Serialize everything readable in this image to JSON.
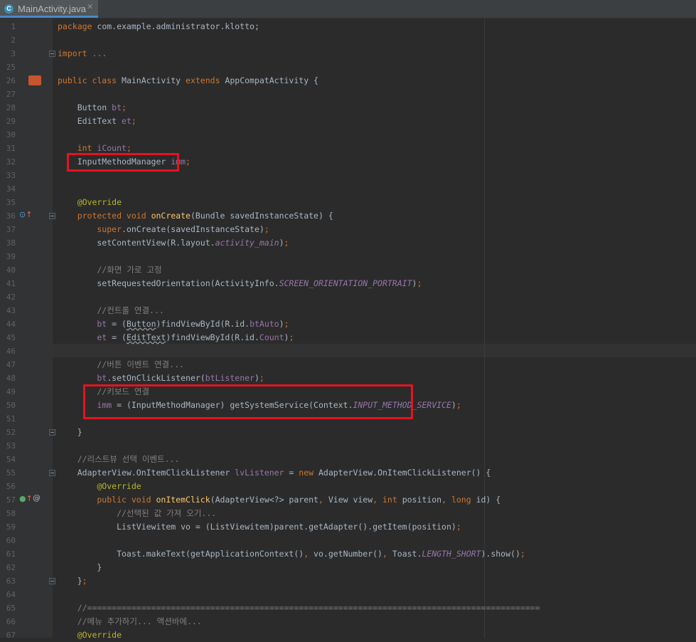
{
  "tab": {
    "filename": "MainActivity.java",
    "icon": "C",
    "close": "✕"
  },
  "colors": {
    "background": "#2b2b2b",
    "keyword": "#cc7832",
    "comment": "#808080",
    "annotation": "#bbb529",
    "method": "#ffc66d",
    "field": "#9876aa",
    "text": "#a9b7c6",
    "highlight_box": "#e4141f"
  },
  "lines": [
    {
      "n": "1",
      "t": [
        [
          "kw",
          "package "
        ],
        [
          "",
          "com.example.administrator.klotto;"
        ]
      ]
    },
    {
      "n": "2",
      "t": []
    },
    {
      "n": "3",
      "t": [
        [
          "kw",
          "import "
        ],
        [
          "cm",
          "..."
        ]
      ]
    },
    {
      "n": "25",
      "t": []
    },
    {
      "n": "26",
      "t": [
        [
          "kw",
          "public class "
        ],
        [
          "",
          "MainActivity "
        ],
        [
          "kw",
          "extends "
        ],
        [
          "",
          "AppCompatActivity {"
        ]
      ]
    },
    {
      "n": "27",
      "t": []
    },
    {
      "n": "28",
      "t": [
        [
          "",
          "    Button "
        ],
        [
          "fd",
          "bt"
        ],
        [
          "kw",
          ";"
        ]
      ]
    },
    {
      "n": "29",
      "t": [
        [
          "",
          "    EditText "
        ],
        [
          "fd",
          "et"
        ],
        [
          "kw",
          ";"
        ]
      ]
    },
    {
      "n": "30",
      "t": []
    },
    {
      "n": "31",
      "t": [
        [
          "kw",
          "    int "
        ],
        [
          "fd",
          "iCount"
        ],
        [
          "kw",
          ";"
        ]
      ]
    },
    {
      "n": "32",
      "t": [
        [
          "",
          "    InputMethodManager "
        ],
        [
          "fd",
          "imm"
        ],
        [
          "kw",
          ";"
        ]
      ]
    },
    {
      "n": "33",
      "t": []
    },
    {
      "n": "34",
      "t": []
    },
    {
      "n": "35",
      "t": [
        [
          "an",
          "    @Override"
        ]
      ]
    },
    {
      "n": "36",
      "t": [
        [
          "kw",
          "    protected void "
        ],
        [
          "fn",
          "onCreate"
        ],
        [
          "",
          "(Bundle savedInstanceState) {"
        ]
      ]
    },
    {
      "n": "37",
      "t": [
        [
          "kw",
          "        super"
        ],
        [
          "",
          "."
        ],
        [
          "",
          "onCreate(savedInstanceState)"
        ],
        [
          "kw",
          ";"
        ]
      ]
    },
    {
      "n": "38",
      "t": [
        [
          "",
          "        setContentView(R.layout."
        ],
        [
          "fdi",
          "activity_main"
        ],
        [
          "",
          ")"
        ],
        [
          "kw",
          ";"
        ]
      ]
    },
    {
      "n": "39",
      "t": []
    },
    {
      "n": "40",
      "t": [
        [
          "cm",
          "        //화면 가로 고정"
        ]
      ]
    },
    {
      "n": "41",
      "t": [
        [
          "",
          "        setRequestedOrientation(ActivityInfo."
        ],
        [
          "fdi",
          "SCREEN_ORIENTATION_PORTRAIT"
        ],
        [
          "",
          ")"
        ],
        [
          "kw",
          ";"
        ]
      ]
    },
    {
      "n": "42",
      "t": []
    },
    {
      "n": "43",
      "t": [
        [
          "cm",
          "        //컨트롤 연결..."
        ]
      ]
    },
    {
      "n": "44",
      "t": [
        [
          "fd",
          "        bt"
        ],
        [
          "",
          " = ("
        ],
        [
          "sq",
          "Button"
        ],
        [
          "",
          ")findViewById(R.id."
        ],
        [
          "fd",
          "btAuto"
        ],
        [
          "",
          ")"
        ],
        [
          "kw",
          ";"
        ]
      ]
    },
    {
      "n": "45",
      "t": [
        [
          "fd",
          "        et"
        ],
        [
          "",
          " = ("
        ],
        [
          "sq",
          "EditText"
        ],
        [
          "",
          ")findViewById(R.id."
        ],
        [
          "fd",
          "Count"
        ],
        [
          "",
          ")"
        ],
        [
          "kw",
          ";"
        ]
      ]
    },
    {
      "n": "46",
      "t": []
    },
    {
      "n": "47",
      "t": [
        [
          "cm",
          "        //버튼 이벤트 연결..."
        ]
      ]
    },
    {
      "n": "48",
      "t": [
        [
          "fd",
          "        bt"
        ],
        [
          "",
          ".setOnClickListener("
        ],
        [
          "fd",
          "btListener"
        ],
        [
          "",
          ")"
        ],
        [
          "kw",
          ";"
        ]
      ]
    },
    {
      "n": "49",
      "t": [
        [
          "cm",
          "        //키보드 연결"
        ]
      ]
    },
    {
      "n": "50",
      "t": [
        [
          "fd",
          "        imm"
        ],
        [
          "",
          " = (InputMethodManager) getSystemService(Context."
        ],
        [
          "fdi",
          "INPUT_METHOD_SERVICE"
        ],
        [
          "",
          ")"
        ],
        [
          "kw",
          ";"
        ]
      ]
    },
    {
      "n": "51",
      "t": []
    },
    {
      "n": "52",
      "t": [
        [
          "",
          "    }"
        ]
      ]
    },
    {
      "n": "53",
      "t": []
    },
    {
      "n": "54",
      "t": [
        [
          "cm",
          "    //리스트뷰 선택 이벤트..."
        ]
      ]
    },
    {
      "n": "55",
      "t": [
        [
          "",
          "    AdapterView.OnItemClickListener "
        ],
        [
          "fd",
          "lvListener"
        ],
        [
          "",
          " = "
        ],
        [
          "kw",
          "new "
        ],
        [
          "",
          "AdapterView.OnItemClickListener() {"
        ]
      ]
    },
    {
      "n": "56",
      "t": [
        [
          "an",
          "        @Override"
        ]
      ]
    },
    {
      "n": "57",
      "t": [
        [
          "kw",
          "        public void "
        ],
        [
          "fn",
          "onItemClick"
        ],
        [
          "",
          "(AdapterView<?> parent"
        ],
        [
          "kw",
          ", "
        ],
        [
          "",
          "View view"
        ],
        [
          "kw",
          ", int "
        ],
        [
          "",
          "position"
        ],
        [
          "kw",
          ", long "
        ],
        [
          "",
          "id) {"
        ]
      ]
    },
    {
      "n": "58",
      "t": [
        [
          "cm",
          "            //선택된 값 가져 오기..."
        ]
      ]
    },
    {
      "n": "59",
      "t": [
        [
          "",
          "            ListViewitem vo = (ListViewitem)parent.getAdapter().getItem(position)"
        ],
        [
          "kw",
          ";"
        ]
      ]
    },
    {
      "n": "60",
      "t": []
    },
    {
      "n": "61",
      "t": [
        [
          "",
          "            Toast."
        ],
        [
          "",
          "makeText(getApplicationContext()"
        ],
        [
          "kw",
          ", "
        ],
        [
          "",
          "vo.getNumber()"
        ],
        [
          "kw",
          ", "
        ],
        [
          "",
          "Toast."
        ],
        [
          "fdi",
          "LENGTH_SHORT"
        ],
        [
          "",
          ").show()"
        ],
        [
          "kw",
          ";"
        ]
      ]
    },
    {
      "n": "62",
      "t": [
        [
          "",
          "        }"
        ]
      ]
    },
    {
      "n": "63",
      "t": [
        [
          "",
          "    }"
        ],
        [
          "kw",
          ";"
        ]
      ]
    },
    {
      "n": "64",
      "t": []
    },
    {
      "n": "65",
      "t": [
        [
          "cm",
          "    //============================================================================================"
        ]
      ]
    },
    {
      "n": "66",
      "t": [
        [
          "cm",
          "    //메뉴 추가하기... 액션바에..."
        ]
      ]
    },
    {
      "n": "67",
      "t": [
        [
          "an",
          "    @Override"
        ]
      ]
    }
  ]
}
